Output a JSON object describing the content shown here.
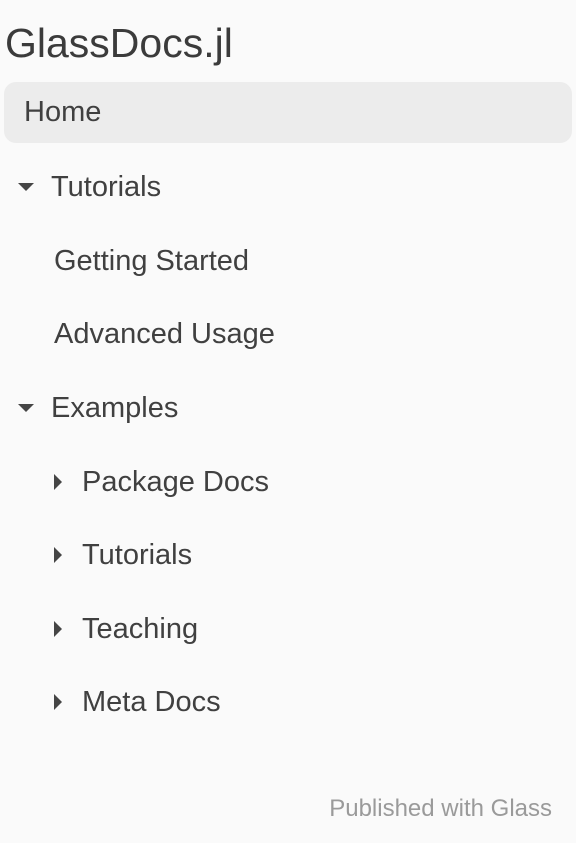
{
  "site": {
    "title": "GlassDocs.jl"
  },
  "nav": {
    "home": "Home",
    "tutorials": {
      "label": "Tutorials",
      "children": [
        "Getting Started",
        "Advanced Usage"
      ]
    },
    "examples": {
      "label": "Examples",
      "children": [
        "Package Docs",
        "Tutorials",
        "Teaching",
        "Meta Docs"
      ]
    }
  },
  "footer": {
    "text": "Published with Glass"
  }
}
